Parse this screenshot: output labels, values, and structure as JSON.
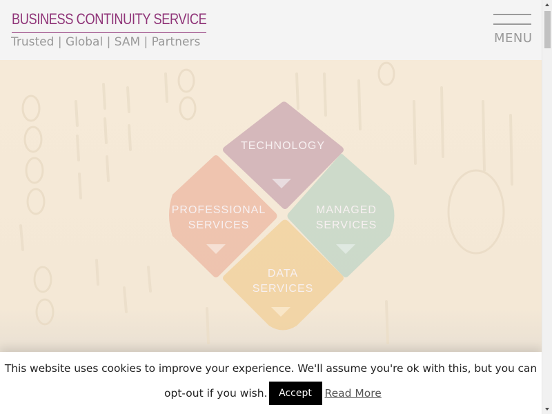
{
  "header": {
    "brand_title": "BUSINESS CONTINUITY SERVICES",
    "tagline": "Trusted | Global | SAM | Partners",
    "menu_label": "MENU"
  },
  "hero": {
    "diagram": {
      "technology": {
        "line1": "TECHNOLOGY",
        "color": "#c9a7b1"
      },
      "professional": {
        "line1": "PROFESSIONAL",
        "line2": "SERVICES",
        "color": "#ecb7a2"
      },
      "managed": {
        "line1": "MANAGED",
        "line2": "SERVICES",
        "color": "#bfd4c5"
      },
      "data": {
        "line1": "DATA",
        "line2": "SERVICES",
        "color": "#f2cf97"
      }
    }
  },
  "cookie": {
    "message": "This website uses cookies to improve your experience. We'll assume you're ok with this, but you can",
    "message_cont": "opt-out if you wish.",
    "accept_label": "Accept",
    "read_more_label": "Read More"
  },
  "colors": {
    "brand": "#8f3478",
    "muted_text": "#9a9a9a",
    "hero_bg": "#f6ead8"
  }
}
